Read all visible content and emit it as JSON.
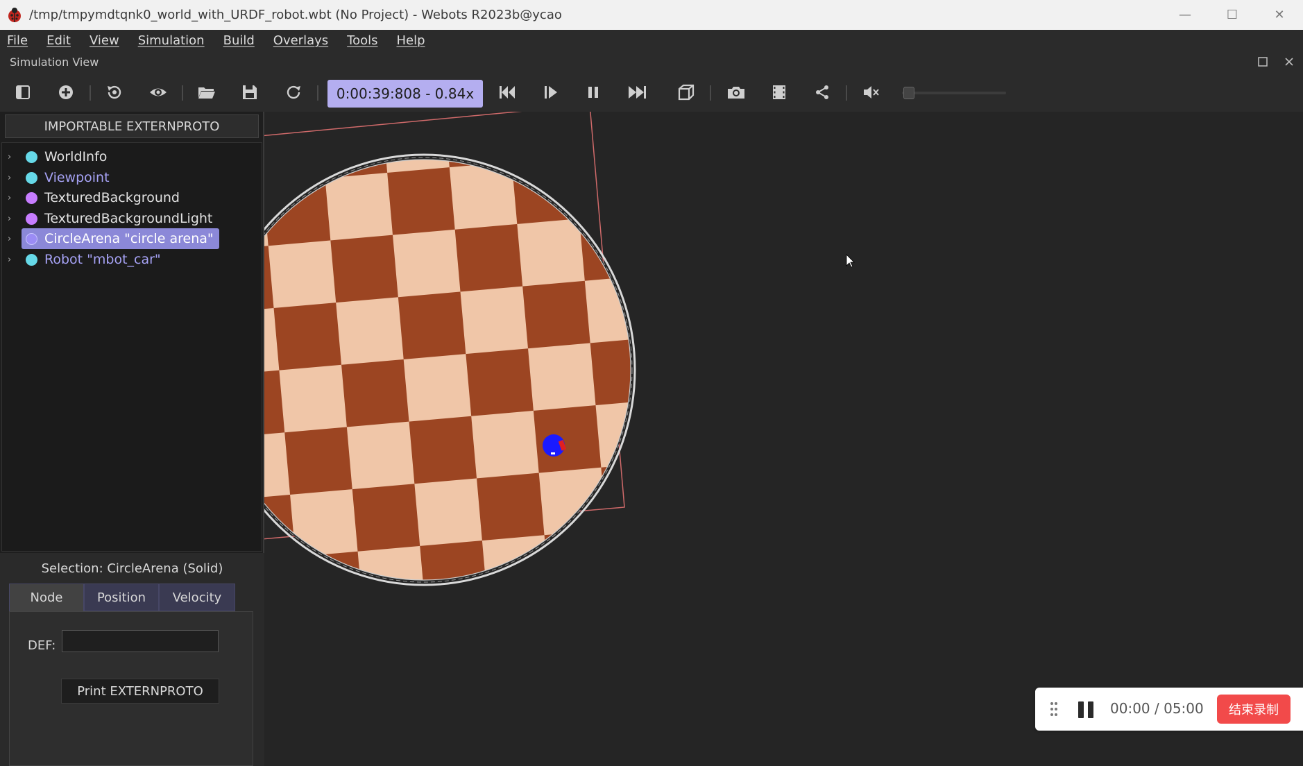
{
  "window": {
    "title": "/tmp/tmpymdtqnk0_world_with_URDF_robot.wbt (No Project) - Webots R2023b@ycao",
    "minimize_glyph": "—",
    "maximize_glyph": "☐",
    "close_glyph": "✕"
  },
  "menu": [
    "File",
    "Edit",
    "View",
    "Simulation",
    "Build",
    "Overlays",
    "Tools",
    "Help"
  ],
  "sim_view": {
    "label": "Simulation View"
  },
  "toolbar": {
    "time_display": "0:00:39:808  -  0.84x"
  },
  "scene_tree": {
    "import_button": "IMPORTABLE EXTERNPROTO",
    "nodes": [
      {
        "label": "WorldInfo",
        "dot_color": "#66d9e8",
        "text_color": "#e2e2e2"
      },
      {
        "label": "Viewpoint",
        "dot_color": "#66d9e8",
        "text_color": "#a6a2f5"
      },
      {
        "label": "TexturedBackground",
        "dot_color": "#c77dff",
        "text_color": "#e2e2e2"
      },
      {
        "label": "TexturedBackgroundLight",
        "dot_color": "#c77dff",
        "text_color": "#e2e2e2"
      },
      {
        "label": "CircleArena \"circle arena\"",
        "dot_color": "#9b8cf5",
        "text_color": "#ffffff",
        "selected": true
      },
      {
        "label": "Robot \"mbot_car\"",
        "dot_color": "#66d9e8",
        "text_color": "#a6a2f5"
      }
    ]
  },
  "selection": {
    "label": "Selection: CircleArena (Solid)",
    "tabs": [
      "Node",
      "Position",
      "Velocity"
    ],
    "def_label": "DEF:",
    "def_value": "",
    "print_button": "Print EXTERNPROTO"
  },
  "recorder": {
    "time": "00:00 / 05:00",
    "stop_button": "结束录制"
  },
  "colors": {
    "accent": "#b4aef0",
    "selection": "#8b88d8",
    "record_red": "#f24a4a",
    "checker_light": "#f0c6a8",
    "checker_dark": "#9c4522"
  }
}
